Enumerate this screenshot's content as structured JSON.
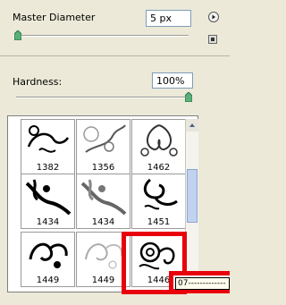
{
  "master_diameter": {
    "label": "Master Diameter",
    "value": "5 px"
  },
  "hardness": {
    "label": "Hardness:",
    "value": "100%"
  },
  "brushes": [
    {
      "number": "1382"
    },
    {
      "number": "1356"
    },
    {
      "number": "1462"
    },
    {
      "number": "1434"
    },
    {
      "number": "1434"
    },
    {
      "number": "1451"
    },
    {
      "number": "1449"
    },
    {
      "number": "1449"
    },
    {
      "number": "1446"
    }
  ],
  "tooltip": {
    "text": "07-------------"
  },
  "colors": {
    "highlight": "#e8000b",
    "panel_bg": "#ece9d8",
    "slider_thumb": "#5ab07a"
  },
  "icons": {
    "flyout": "menu-arrow-icon",
    "save": "new-preset-icon"
  }
}
